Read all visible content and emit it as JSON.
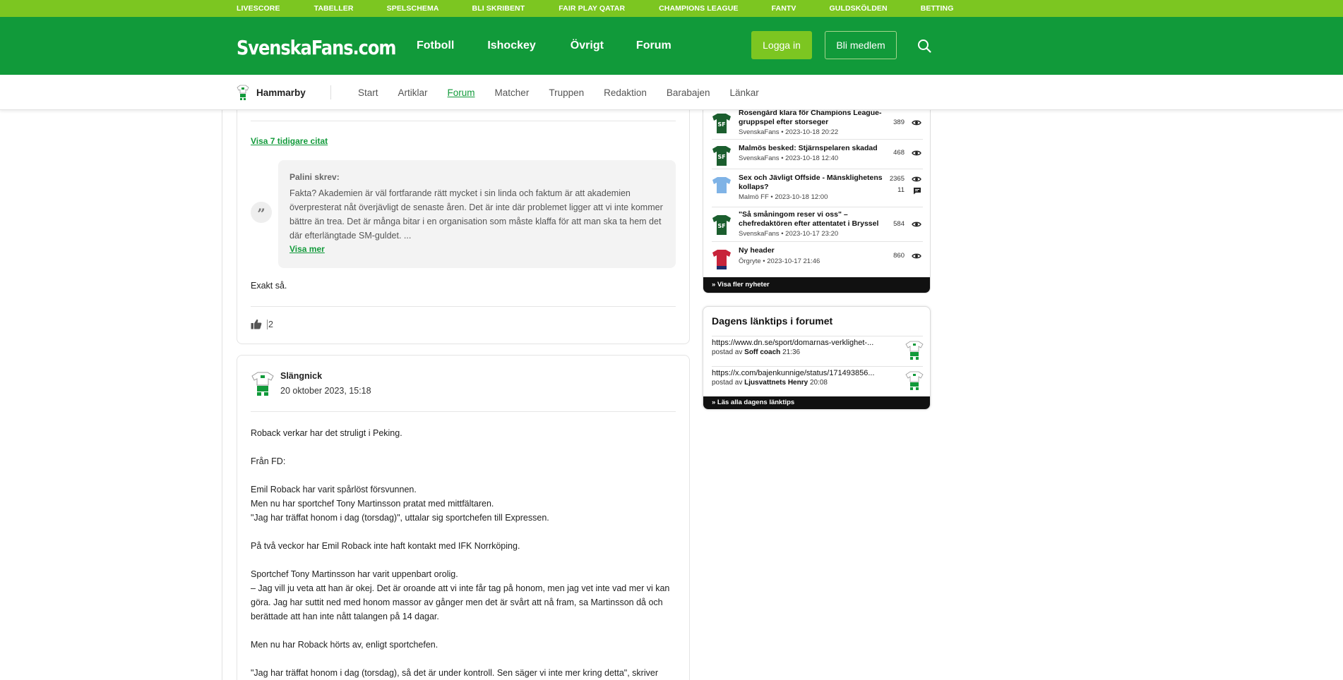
{
  "top_links": [
    "LIVESCORE",
    "TABELLER",
    "SPELSCHEMA",
    "BLI SKRIBENT",
    "FAIR PLAY QATAR",
    "CHAMPIONS LEAGUE",
    "FANTV",
    "GULDSKÖLDEN",
    "BETTING"
  ],
  "header": {
    "logo": "SvenskaFans.com",
    "nav": [
      "Fotboll",
      "Ishockey",
      "Övrigt",
      "Forum"
    ],
    "login": "Logga in",
    "member": "Bli medlem"
  },
  "subnav": {
    "club": "Hammarby",
    "links": [
      "Start",
      "Artiklar",
      "Forum",
      "Matcher",
      "Truppen",
      "Redaktion",
      "Barabajen",
      "Länkar"
    ],
    "active": "Forum"
  },
  "post1": {
    "show_quotes": "Visa 7 tidigare citat",
    "quote_author": "Palini skrev:",
    "quote_text": "Fakta? Akademien är väl fortfarande rätt mycket i sin linda och faktum är att akademien överpresterat nåt överjävligt de senaste åren. Det är inte där problemet ligger att vi inte kommer bättre än trea. Det är många bitar i en organisation som måste klaffa för att man ska ta hem det där efterlängtade SM-guldet. ...",
    "quote_more": "Visa mer",
    "reply": "Exakt så.",
    "likes": "2"
  },
  "post2": {
    "author": "Slängnick",
    "date": "20 oktober 2023, 15:18",
    "paragraphs": [
      "Roback verkar har det struligt i Peking.",
      "Från FD:",
      "Emil Roback har varit spårlöst försvunnen.\nMen nu har sportchef Tony Martinsson pratat med mittfältaren.\n\"Jag har träffat honom i dag (torsdag)\", uttalar sig sportchefen till Expressen.",
      "På två veckor har Emil Roback inte haft kontakt med IFK Norrköping.",
      "Sportchef Tony Martinsson har varit uppenbart orolig.\n– Jag vill ju veta att han är okej. Det är oroande att vi inte får tag på honom, men jag vet inte vad mer vi kan göra. Jag har suttit ned med honom massor av gånger men det är svårt att nå fram, sa Martinsson då och berättade att han inte nått talangen på 14 dagar.",
      "Men nu har Roback hörts av, enligt sportchefen.",
      "\"Jag har träffat honom i dag (torsdag), så det är under kontroll. Sen säger vi inte mer kring detta\", skriver"
    ]
  },
  "news": {
    "items": [
      {
        "title": "Rosengård klara för Champions League-gruppspel efter storseger",
        "meta": "SvenskaFans • 2023-10-18 20:22",
        "views": "389",
        "comments": "",
        "kit": "sf"
      },
      {
        "title": "Malmös besked: Stjärnspelaren skadad",
        "meta": "SvenskaFans • 2023-10-18 12:40",
        "views": "468",
        "comments": "",
        "kit": "sf"
      },
      {
        "title": "Sex och Jävligt Offside - Mänsklighetens kollaps?",
        "meta": "Malmö FF • 2023-10-18 12:00",
        "views": "2365",
        "comments": "11",
        "kit": "mff"
      },
      {
        "title": "\"Så småningom reser vi oss\" – chefredaktören efter attentatet i Bryssel",
        "meta": "SvenskaFans • 2023-10-17 23:20",
        "views": "584",
        "comments": "",
        "kit": "sf"
      },
      {
        "title": "Ny header",
        "meta": "Örgryte • 2023-10-17 21:46",
        "views": "860",
        "comments": "",
        "kit": "ois"
      }
    ],
    "more": "» Visa fler nyheter"
  },
  "links_box": {
    "title": "Dagens länktips i forumet",
    "items": [
      {
        "url": "https://www.dn.se/sport/domarnas-verklighet-...",
        "prefix": "postad av",
        "user": "Soff coach",
        "time": "21:36"
      },
      {
        "url": "https://x.com/bajenkunnige/status/171493856...",
        "prefix": "postad av",
        "user": "Ljusvattnets Henry",
        "time": "20:08"
      }
    ],
    "all": "» Läs alla dagens länktips"
  },
  "colors": {
    "brand_green": "#119a3a",
    "lime": "#7cc621"
  }
}
